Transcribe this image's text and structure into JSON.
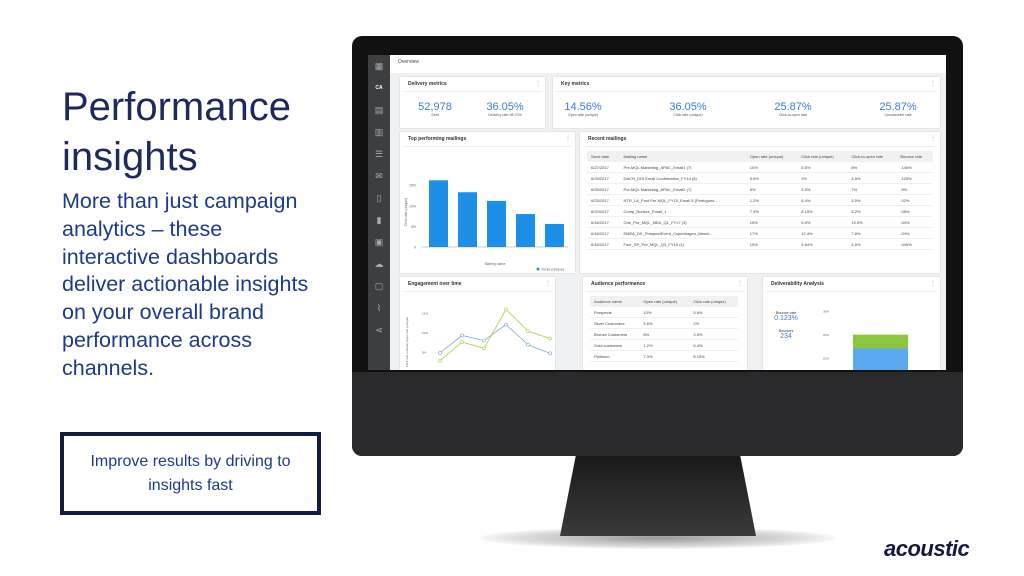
{
  "slide": {
    "title_line1": "Performance",
    "title_line2": "insights",
    "body": "More than just campaign analytics – these interactive dashboards deliver actionable insights on your overall brand performance across channels.",
    "callout": "Improve results by driving to insights fast",
    "logo": "acoustic"
  },
  "colors": {
    "title": "#1e2a5c",
    "body": "#1e3a8a",
    "accent_blue": "#3d7ec9",
    "bar_blue": "#1e8fe6",
    "line_green": "#a8d13b",
    "line_blue": "#7fa6d9",
    "deliv_green": "#8cc63f",
    "deliv_blue": "#5aaaf0"
  },
  "dashboard": {
    "sidebar": {
      "icons": [
        "grid-icon",
        "user-initials",
        "report-icon",
        "chart-icon",
        "database-icon",
        "mail-icon",
        "mobile-icon",
        "device-icon",
        "layout-icon",
        "cloud-icon",
        "file-icon",
        "graph-icon",
        "share-icon"
      ],
      "initials": "CA"
    },
    "header": "Overview",
    "delivery": {
      "title": "Delivery metrics",
      "metrics": [
        {
          "value": "52,978",
          "label": "Sent"
        },
        {
          "value": "36.05%",
          "label": "Delivery rate 98.70%"
        }
      ]
    },
    "key": {
      "title": "Key metrics",
      "metrics": [
        {
          "value": "14.56%",
          "label": "Open rate (unique)"
        },
        {
          "value": "36.05%",
          "label": "Click rate (unique)"
        },
        {
          "value": "25.87%",
          "label": "Click-to-open rate"
        },
        {
          "value": "25.87%",
          "label": "Unsubscribe rate"
        }
      ]
    },
    "top": {
      "title": "Top performing mailings"
    },
    "recent": {
      "title": "Recent mailings",
      "headers": [
        "Send date",
        "Mailing name",
        "Open rate (unique)",
        "Click rate (unique)",
        "Click-to-open rate",
        "Bounce rate"
      ],
      "rows": [
        [
          "6/27/2017",
          "Pre-MQL Marketing_APAC_Email1 (7)",
          "10%",
          "5.6%",
          "8%",
          ".145%"
        ],
        [
          "6/25/2017",
          "DACH_DOI Email Confirmation_FY14 (8)",
          "5.6%",
          "2%",
          "4.5%",
          ".125%"
        ],
        [
          "6/25/2017",
          "Pre-MQL Marketing_APAC_Email2 (7)",
          "8%",
          "3.5%",
          "7%",
          ".5%"
        ],
        [
          "6/23/2017",
          "NTR_LA_Post Pre MQL_FY15_Email 5 (Portugues...",
          "1.2%",
          "6.4%",
          "5.5%",
          ".02%"
        ],
        [
          "6/20/2017",
          "Comp_Nurture_Email_1",
          "7.3%",
          "8.15%",
          "8.2%",
          ".08%"
        ],
        [
          "6/18/2017",
          "One_Pre_MQL_MEA_Q1_FY17 (3)",
          "10%",
          "6.5%",
          "10.5%",
          ".04%"
        ],
        [
          "6/18/2017",
          "EMEA_DK_ProspectEvent_Copenhagen_March...",
          "17%",
          "12.4%",
          "7.6%",
          ".04%"
        ],
        [
          "6/16/2017",
          "Four_SP_Pre_MQL_Q3_FY16 (4)",
          "15%",
          "5.64%",
          "4.5%",
          ".045%"
        ]
      ]
    },
    "engagement": {
      "title": "Engagement over time"
    },
    "audience": {
      "title": "Audience performance",
      "headers": [
        "Audience name",
        "Open rate (unique)",
        "Click rate (unique)"
      ],
      "rows": [
        [
          "Prospects",
          "10%",
          "5.6%"
        ],
        [
          "Silver Customers",
          "5.6%",
          "2%"
        ],
        [
          "Bronze Customers",
          "8%",
          "3.5%"
        ],
        [
          "Gold customers",
          "1.2%",
          "6.4%"
        ],
        [
          "Platinum",
          "7.3%",
          "8.15%"
        ]
      ]
    },
    "deliverability": {
      "title": "Deliverability Analysis",
      "bounce_rate_label": "Bounce rate",
      "bounce_rate": "0.123%",
      "bounces_label": "Bounces",
      "bounces": "234"
    }
  },
  "chart_data": [
    {
      "type": "bar",
      "title": "Top performing mailings",
      "xlabel": "Mailing name",
      "ylabel": "Click rate (unique)",
      "yticks": [
        "0",
        "5%",
        "10%",
        "15%"
      ],
      "ylim": [
        0,
        17
      ],
      "values": [
        16.2,
        13.3,
        11.2,
        8,
        5.6
      ],
      "legend": "Clicks (unique)",
      "legend_position": "bottom-right"
    },
    {
      "type": "line",
      "title": "Engagement over time",
      "ylabel": "Click rate (unique) Open rate (unique)",
      "yticks": [
        "5%",
        "10%",
        "15%"
      ],
      "ylim": [
        0,
        18
      ],
      "series": [
        {
          "color": "#7fa6d9",
          "values": [
            4.9,
            9.4,
            8.1,
            12.2,
            7.0,
            4.8
          ]
        },
        {
          "color": "#a8d13b",
          "values": [
            2.9,
            7.7,
            6.1,
            16.1,
            10.5,
            8.6
          ]
        }
      ]
    },
    {
      "type": "bar",
      "stacked": true,
      "title": "Deliverability Analysis",
      "yticks": [
        "10%",
        "20%",
        "30%"
      ],
      "ylim": [
        0,
        32
      ],
      "series": [
        {
          "color": "#5aaaf0",
          "values": [
            14.3
          ]
        },
        {
          "color": "#8cc63f",
          "values": [
            5.9
          ]
        }
      ]
    }
  ]
}
